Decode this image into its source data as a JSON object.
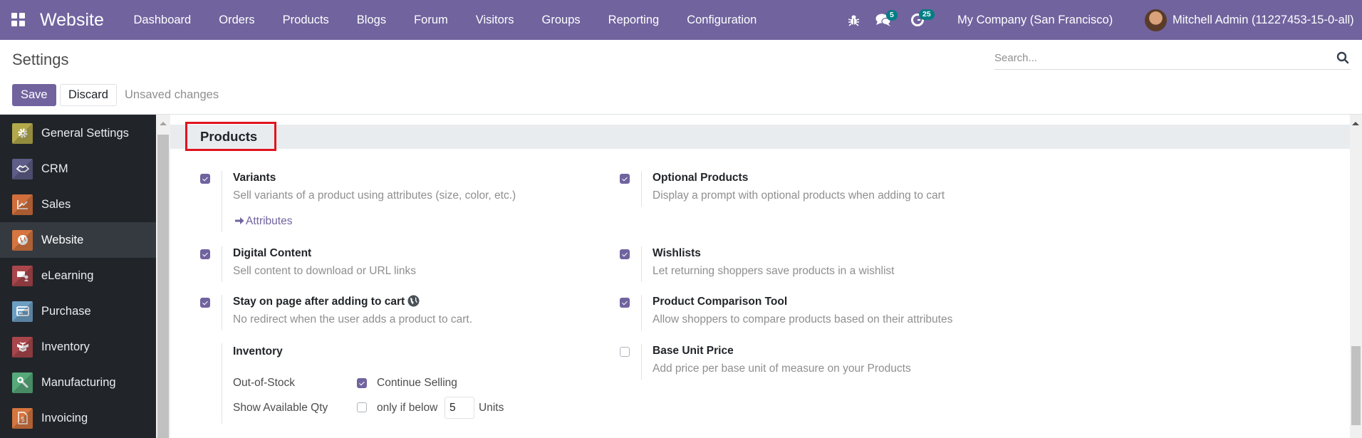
{
  "navbar": {
    "app_name": "Website",
    "menu": [
      "Dashboard",
      "Orders",
      "Products",
      "Blogs",
      "Forum",
      "Visitors",
      "Groups",
      "Reporting",
      "Configuration"
    ],
    "messages_count": "5",
    "activities_count": "25",
    "company": "My Company (San Francisco)",
    "user": "Mitchell Admin (11227453-15-0-all)"
  },
  "control_panel": {
    "title": "Settings",
    "search_placeholder": "Search...",
    "save_label": "Save",
    "discard_label": "Discard",
    "status": "Unsaved changes"
  },
  "sidebar": {
    "items": [
      {
        "label": "General Settings",
        "icon": "gear-icon",
        "color": "#b3a94b",
        "active": false
      },
      {
        "label": "CRM",
        "icon": "handshake-icon",
        "color": "#5d5d88",
        "active": false
      },
      {
        "label": "Sales",
        "icon": "chart-line-icon",
        "color": "#d06f3c",
        "active": false
      },
      {
        "label": "Website",
        "icon": "globe-icon",
        "color": "#d5753f",
        "active": true
      },
      {
        "label": "eLearning",
        "icon": "presentation-icon",
        "color": "#a9464c",
        "active": false
      },
      {
        "label": "Purchase",
        "icon": "credit-card-icon",
        "color": "#6d9fc4",
        "active": false
      },
      {
        "label": "Inventory",
        "icon": "box-icon",
        "color": "#a9464c",
        "active": false
      },
      {
        "label": "Manufacturing",
        "icon": "wrench-icon",
        "color": "#56a97a",
        "active": false
      },
      {
        "label": "Invoicing",
        "icon": "invoice-icon",
        "color": "#d5753f",
        "active": false
      }
    ]
  },
  "section": {
    "title": "Products",
    "settings_left": {
      "variants": {
        "title": "Variants",
        "desc": "Sell variants of a product using attributes (size, color, etc.)",
        "checked": true,
        "link": "Attributes"
      },
      "digital_content": {
        "title": "Digital Content",
        "desc": "Sell content to download or URL links",
        "checked": true
      },
      "stay_on_page": {
        "title": "Stay on page after adding to cart",
        "desc": "No redirect when the user adds a product to cart.",
        "checked": true
      },
      "inventory": {
        "title": "Inventory",
        "out_of_stock_label": "Out-of-Stock",
        "continue_selling_label": "Continue Selling",
        "continue_selling_checked": true,
        "show_qty_label": "Show Available Qty",
        "only_if_below_label": "only if below",
        "show_qty_checked": false,
        "threshold_value": "5",
        "units_label": "Units"
      }
    },
    "settings_right": {
      "optional_products": {
        "title": "Optional Products",
        "desc": "Display a prompt with optional products when adding to cart",
        "checked": true
      },
      "wishlists": {
        "title": "Wishlists",
        "desc": "Let returning shoppers save products in a wishlist",
        "checked": true
      },
      "comparison": {
        "title": "Product Comparison Tool",
        "desc": "Allow shoppers to compare products based on their attributes",
        "checked": true
      },
      "base_unit_price": {
        "title": "Base Unit Price",
        "desc": "Add price per base unit of measure on your Products",
        "checked": false
      }
    }
  },
  "colors": {
    "brand": "#71639e",
    "badge": "#017e84",
    "highlight": "#e0141e",
    "sidebar_bg": "#212529"
  }
}
